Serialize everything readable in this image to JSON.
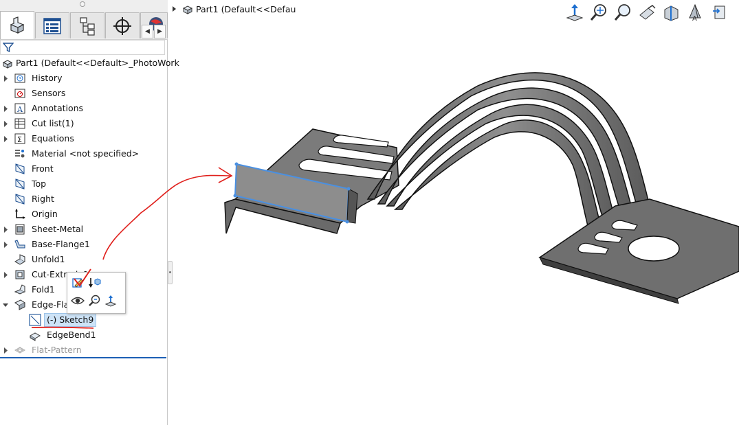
{
  "feature_manager": {
    "tabs": [
      {
        "name": "feature-manager-tab",
        "icon": "part-icon",
        "active": true
      },
      {
        "name": "property-manager-tab",
        "icon": "property-list-icon",
        "active": false
      },
      {
        "name": "configuration-manager-tab",
        "icon": "configuration-icon",
        "active": false
      },
      {
        "name": "dimxpert-manager-tab",
        "icon": "crosshair-icon",
        "active": false
      },
      {
        "name": "display-manager-tab",
        "icon": "appearance-sphere-icon",
        "active": false
      }
    ],
    "root_label": "Part1  (Default<<Default>_PhotoWork",
    "tree": [
      {
        "label": "History",
        "icon": "history-icon",
        "expander": true
      },
      {
        "label": "Sensors",
        "icon": "sensor-icon",
        "expander": false
      },
      {
        "label": "Annotations",
        "icon": "annotations-icon",
        "expander": true
      },
      {
        "label": "Cut list(1)",
        "icon": "cut-list-icon",
        "expander": true
      },
      {
        "label": "Equations",
        "icon": "equations-icon",
        "expander": true
      },
      {
        "label": "Material <not specified>",
        "icon": "material-icon",
        "expander": false
      },
      {
        "label": "Front",
        "icon": "plane-icon",
        "expander": false
      },
      {
        "label": "Top",
        "icon": "plane-icon",
        "expander": false
      },
      {
        "label": "Right",
        "icon": "plane-icon",
        "expander": false
      },
      {
        "label": "Origin",
        "icon": "origin-icon",
        "expander": false
      },
      {
        "label": "Sheet-Metal",
        "icon": "sheet-metal-icon",
        "expander": true
      },
      {
        "label": "Base-Flange1",
        "icon": "base-flange-icon",
        "expander": true
      },
      {
        "label": "Unfold1",
        "icon": "unfold-icon",
        "expander": false
      },
      {
        "label": "Cut-Extrude1",
        "icon": "cut-extrude-icon",
        "expander": true
      },
      {
        "label": "Fold1",
        "icon": "fold-icon",
        "expander": false
      },
      {
        "label": "Edge-Flange1",
        "icon": "edge-flange-icon",
        "expander": true,
        "expanded": true
      },
      {
        "label": "(-) Sketch9",
        "icon": "sketch-icon",
        "expander": false,
        "indent": 1,
        "selected": true
      },
      {
        "label": "EdgeBend1",
        "icon": "edge-bend-icon",
        "expander": false,
        "indent": 1
      },
      {
        "label": "Flat-Pattern",
        "icon": "flat-pattern-icon",
        "expander": true,
        "greyed": true
      }
    ]
  },
  "context_toolbar": {
    "buttons": [
      "edit-sketch-icon",
      "rollback-icon",
      "hide-show-icon",
      "zoom-to-selection-icon",
      "normal-to-icon"
    ]
  },
  "graphics": {
    "breadcrumb": "Part1  (Default<<Defau",
    "heads_up_toolbar": [
      "view-orientation-icon",
      "zoom-to-fit-icon",
      "zoom-to-area-icon",
      "previous-view-icon",
      "section-view-icon",
      "display-style-icon",
      "hide-show-items-icon"
    ]
  },
  "colors": {
    "selection_blue": "#4a90e2",
    "annotation_red": "#e0201c",
    "sheet_metal_grey": "#7d7d7d",
    "tree_underline_blue": "#1b5fb5"
  }
}
